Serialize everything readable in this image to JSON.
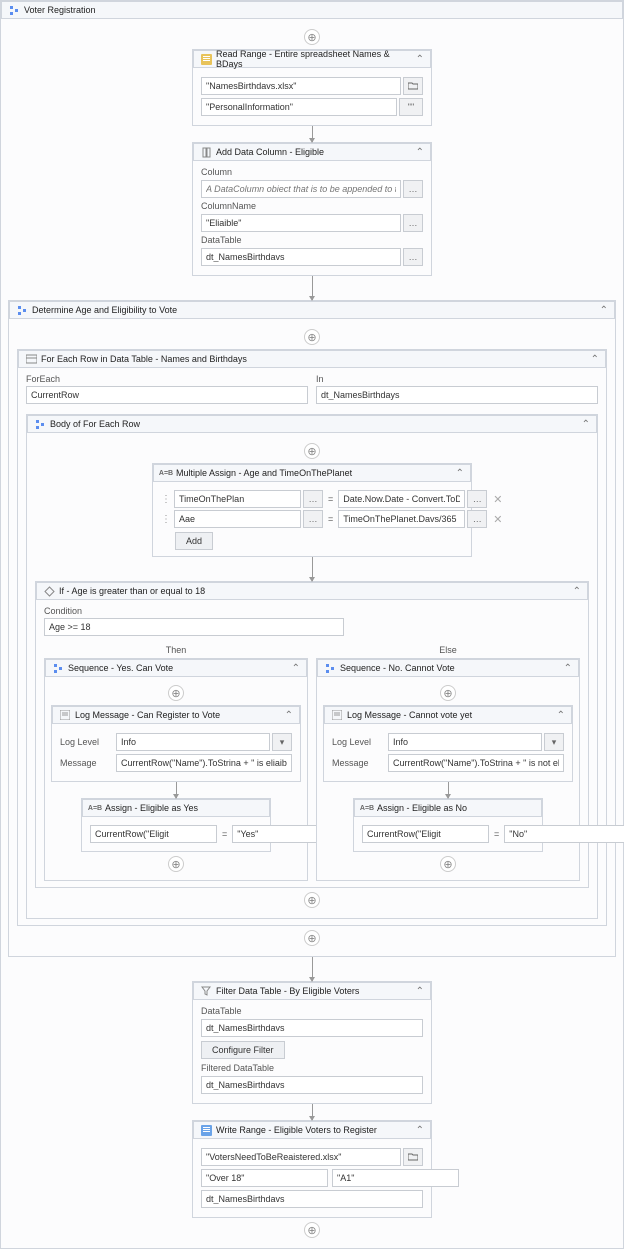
{
  "root": {
    "title": "Voter Registration"
  },
  "readRange": {
    "title": "Read Range - Entire spreadsheet Names & BDays",
    "file": "\"NamesBirthdavs.xlsx\"",
    "sheet": "\"PersonalInformation\"",
    "sheetBtn": "\"\""
  },
  "addCol": {
    "title": "Add Data Column - Eligible",
    "lbl_column": "Column",
    "columnPh": "A DataColumn obiect that is to be appended to th",
    "lbl_colname": "ColumnName",
    "colname": "\"Eliaible\"",
    "lbl_dt": "DataTable",
    "dt": "dt_NamesBirthdavs"
  },
  "determine": {
    "title": "Determine Age and Eligibility to Vote"
  },
  "forEach": {
    "title": "For Each Row in Data Table - Names and Birthdays",
    "lbl_foreach": "ForEach",
    "foreach": "CurrentRow",
    "lbl_in": "In",
    "in": "dt_NamesBirthdays"
  },
  "bodyFE": {
    "title": "Body of For Each Row"
  },
  "massign": {
    "title": "Multiple Assign - Age and TimeOnThePlanet",
    "r1_left": "TimeOnThePlan",
    "r1_right": "Date.Now.Date - Convert.ToDa",
    "r2_left": "Aae",
    "r2_right": "TimeOnThePlanet.Davs/365",
    "addBtn": "Add"
  },
  "ifAct": {
    "title": "If - Age is greater than or equal to 18",
    "lbl_cond": "Condition",
    "cond": "Age >= 18",
    "then": "Then",
    "else": "Else"
  },
  "seqYes": {
    "title": "Sequence - Yes. Can Vote"
  },
  "seqNo": {
    "title": "Sequence - No. Cannot Vote"
  },
  "logYes": {
    "title": "Log Message - Can Register to Vote",
    "lbl_level": "Log Level",
    "level": "Info",
    "lbl_msg": "Message",
    "msg": "CurrentRow(\"Name\").ToStrina + \" is eliaibl"
  },
  "logNo": {
    "title": "Log Message - Cannot vote yet",
    "lbl_level": "Log Level",
    "level": "Info",
    "lbl_msg": "Message",
    "msg": "CurrentRow(\"Name\").ToStrina + \" is not eli"
  },
  "asgYes": {
    "title": "Assign - Eligible as Yes",
    "left": "CurrentRow(\"Eligit",
    "right": "\"Yes\""
  },
  "asgNo": {
    "title": "Assign - Eligible as No",
    "left": "CurrentRow(\"Eligit",
    "right": "\"No\""
  },
  "filter": {
    "title": "Filter Data Table - By Eligible Voters",
    "lbl_dt": "DataTable",
    "dt": "dt_NamesBirthdavs",
    "cfgBtn": "Configure Filter",
    "lbl_fdt": "Filtered DataTable",
    "fdt": "dt_NamesBirthdavs"
  },
  "writeRange": {
    "title": "Write Range - Eligible Voters to Register",
    "file": "\"VotersNeedToBeReaistered.xlsx\"",
    "sheet": "\"Over 18\"",
    "cell": "\"A1\"",
    "dt": "dt_NamesBirthdavs"
  }
}
